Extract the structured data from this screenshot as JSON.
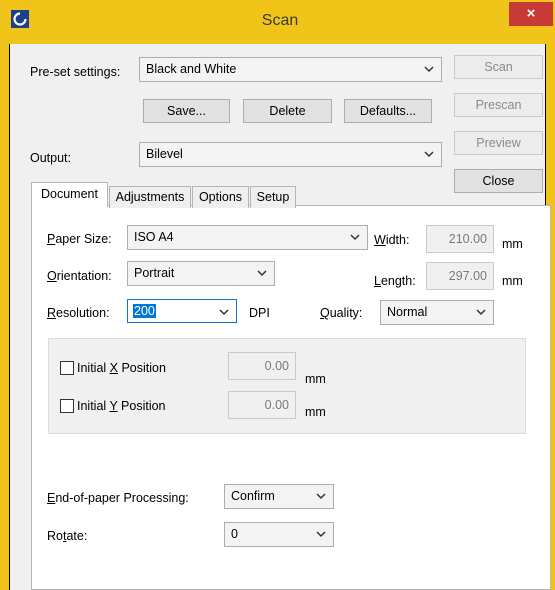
{
  "window": {
    "title": "Scan",
    "close_glyph": "×"
  },
  "preset": {
    "label": "Pre-set settings:",
    "value": "Black and White"
  },
  "buttons": {
    "save": "Save...",
    "delete": "Delete",
    "defaults": "Defaults..."
  },
  "output": {
    "label": "Output:",
    "value": "Bilevel"
  },
  "side_buttons": {
    "scan": "Scan",
    "prescan": "Prescan",
    "preview": "Preview",
    "close": "Close"
  },
  "tabs": [
    "Document",
    "Adjustments",
    "Options",
    "Setup"
  ],
  "document": {
    "paper_size": {
      "label": "Paper Size:",
      "value": "ISO A4"
    },
    "width": {
      "label": "Width:",
      "value": "210.00",
      "unit": "mm"
    },
    "orientation": {
      "label": "Orientation:",
      "value": "Portrait"
    },
    "length": {
      "label": "Length:",
      "value": "297.00",
      "unit": "mm"
    },
    "resolution": {
      "label": "Resolution:",
      "value": "200",
      "unit": "DPI"
    },
    "quality": {
      "label": "Quality:",
      "value": "Normal"
    },
    "initial_x": {
      "label": "Initial X Position",
      "value": "0.00",
      "unit": "mm"
    },
    "initial_y": {
      "label": "Initial Y Position",
      "value": "0.00",
      "unit": "mm"
    },
    "end_of_paper": {
      "label": "End-of-paper Processing:",
      "value": "Confirm"
    },
    "rotate": {
      "label": "Rotate:",
      "value": "0"
    }
  }
}
